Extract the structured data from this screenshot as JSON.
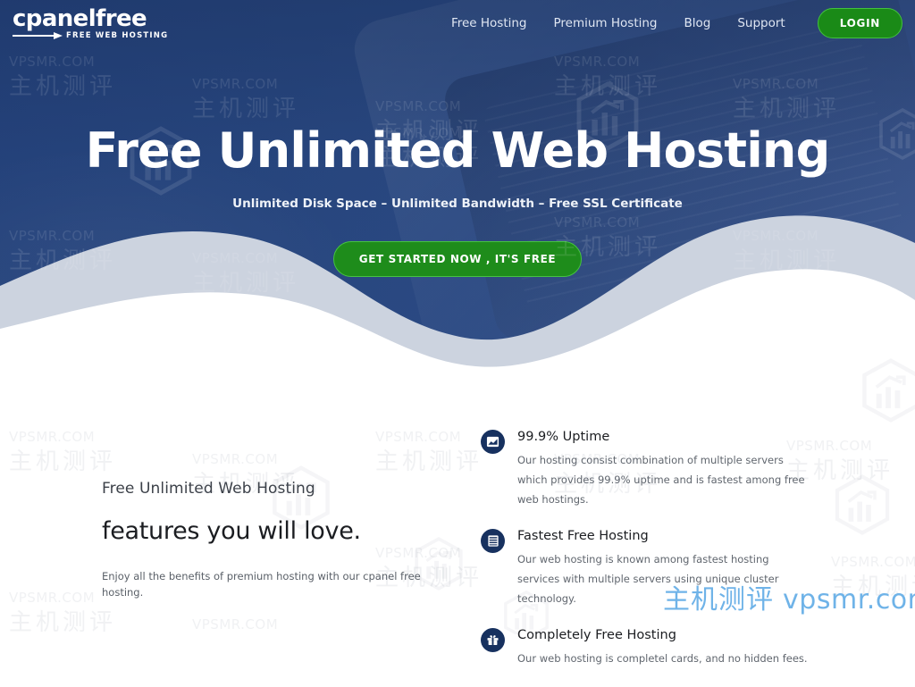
{
  "brand": {
    "logo_word": "cpanelfree",
    "logo_tagline": "FREE WEB HOSTING",
    "accent_green": "#1e8c1b",
    "accent_green_border": "#46c241",
    "navy": "#27467f",
    "icon_navy": "#17315f"
  },
  "nav": {
    "links": [
      {
        "label": "Free Hosting"
      },
      {
        "label": "Premium Hosting"
      },
      {
        "label": "Blog"
      },
      {
        "label": "Support"
      }
    ],
    "login_label": "LOGIN"
  },
  "hero": {
    "title": "Free Unlimited Web Hosting",
    "subtitle": "Unlimited Disk Space – Unlimited Bandwidth – Free SSL Certificate",
    "cta_label": "GET STARTED NOW , IT'S FREE"
  },
  "features": {
    "eyebrow": "Free Unlimited Web Hosting",
    "headline": "features you will love.",
    "lead": "Enjoy all the benefits of premium hosting with our cpanel free hosting.",
    "items": [
      {
        "icon": "chart-area-icon",
        "title": "99.9% Uptime",
        "desc": "Our hosting consist combination of multiple servers which provides 99.9% uptime and is fastest among free web hostings."
      },
      {
        "icon": "server-stack-icon",
        "title": "Fastest Free Hosting",
        "desc": "Our web hosting is known among fastest hosting services with multiple servers using unique cluster technology."
      },
      {
        "icon": "gift-icon",
        "title": "Completely Free Hosting",
        "desc": "Our web hosting is completel cards, and no hidden fees."
      }
    ]
  },
  "watermarks": {
    "english": "VPSMR.COM",
    "chinese": "主机测评",
    "main_cn": "主机测评",
    "main_en": "vpsmr.com",
    "main_color": "#6fb3e8"
  }
}
